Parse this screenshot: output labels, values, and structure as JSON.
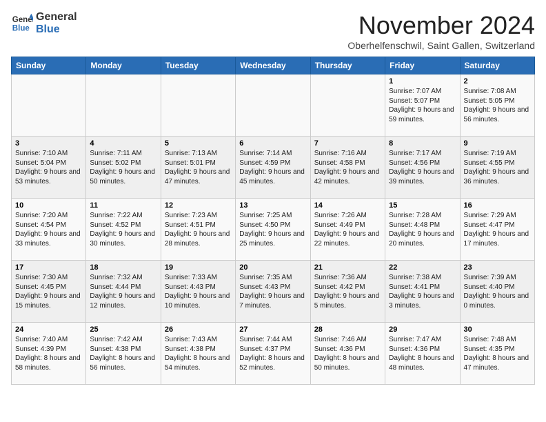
{
  "header": {
    "logo_general": "General",
    "logo_blue": "Blue",
    "month": "November 2024",
    "location": "Oberhelfenschwil, Saint Gallen, Switzerland"
  },
  "weekdays": [
    "Sunday",
    "Monday",
    "Tuesday",
    "Wednesday",
    "Thursday",
    "Friday",
    "Saturday"
  ],
  "weeks": [
    [
      {
        "day": "",
        "info": ""
      },
      {
        "day": "",
        "info": ""
      },
      {
        "day": "",
        "info": ""
      },
      {
        "day": "",
        "info": ""
      },
      {
        "day": "",
        "info": ""
      },
      {
        "day": "1",
        "info": "Sunrise: 7:07 AM\nSunset: 5:07 PM\nDaylight: 9 hours and 59 minutes."
      },
      {
        "day": "2",
        "info": "Sunrise: 7:08 AM\nSunset: 5:05 PM\nDaylight: 9 hours and 56 minutes."
      }
    ],
    [
      {
        "day": "3",
        "info": "Sunrise: 7:10 AM\nSunset: 5:04 PM\nDaylight: 9 hours and 53 minutes."
      },
      {
        "day": "4",
        "info": "Sunrise: 7:11 AM\nSunset: 5:02 PM\nDaylight: 9 hours and 50 minutes."
      },
      {
        "day": "5",
        "info": "Sunrise: 7:13 AM\nSunset: 5:01 PM\nDaylight: 9 hours and 47 minutes."
      },
      {
        "day": "6",
        "info": "Sunrise: 7:14 AM\nSunset: 4:59 PM\nDaylight: 9 hours and 45 minutes."
      },
      {
        "day": "7",
        "info": "Sunrise: 7:16 AM\nSunset: 4:58 PM\nDaylight: 9 hours and 42 minutes."
      },
      {
        "day": "8",
        "info": "Sunrise: 7:17 AM\nSunset: 4:56 PM\nDaylight: 9 hours and 39 minutes."
      },
      {
        "day": "9",
        "info": "Sunrise: 7:19 AM\nSunset: 4:55 PM\nDaylight: 9 hours and 36 minutes."
      }
    ],
    [
      {
        "day": "10",
        "info": "Sunrise: 7:20 AM\nSunset: 4:54 PM\nDaylight: 9 hours and 33 minutes."
      },
      {
        "day": "11",
        "info": "Sunrise: 7:22 AM\nSunset: 4:52 PM\nDaylight: 9 hours and 30 minutes."
      },
      {
        "day": "12",
        "info": "Sunrise: 7:23 AM\nSunset: 4:51 PM\nDaylight: 9 hours and 28 minutes."
      },
      {
        "day": "13",
        "info": "Sunrise: 7:25 AM\nSunset: 4:50 PM\nDaylight: 9 hours and 25 minutes."
      },
      {
        "day": "14",
        "info": "Sunrise: 7:26 AM\nSunset: 4:49 PM\nDaylight: 9 hours and 22 minutes."
      },
      {
        "day": "15",
        "info": "Sunrise: 7:28 AM\nSunset: 4:48 PM\nDaylight: 9 hours and 20 minutes."
      },
      {
        "day": "16",
        "info": "Sunrise: 7:29 AM\nSunset: 4:47 PM\nDaylight: 9 hours and 17 minutes."
      }
    ],
    [
      {
        "day": "17",
        "info": "Sunrise: 7:30 AM\nSunset: 4:45 PM\nDaylight: 9 hours and 15 minutes."
      },
      {
        "day": "18",
        "info": "Sunrise: 7:32 AM\nSunset: 4:44 PM\nDaylight: 9 hours and 12 minutes."
      },
      {
        "day": "19",
        "info": "Sunrise: 7:33 AM\nSunset: 4:43 PM\nDaylight: 9 hours and 10 minutes."
      },
      {
        "day": "20",
        "info": "Sunrise: 7:35 AM\nSunset: 4:43 PM\nDaylight: 9 hours and 7 minutes."
      },
      {
        "day": "21",
        "info": "Sunrise: 7:36 AM\nSunset: 4:42 PM\nDaylight: 9 hours and 5 minutes."
      },
      {
        "day": "22",
        "info": "Sunrise: 7:38 AM\nSunset: 4:41 PM\nDaylight: 9 hours and 3 minutes."
      },
      {
        "day": "23",
        "info": "Sunrise: 7:39 AM\nSunset: 4:40 PM\nDaylight: 9 hours and 0 minutes."
      }
    ],
    [
      {
        "day": "24",
        "info": "Sunrise: 7:40 AM\nSunset: 4:39 PM\nDaylight: 8 hours and 58 minutes."
      },
      {
        "day": "25",
        "info": "Sunrise: 7:42 AM\nSunset: 4:38 PM\nDaylight: 8 hours and 56 minutes."
      },
      {
        "day": "26",
        "info": "Sunrise: 7:43 AM\nSunset: 4:38 PM\nDaylight: 8 hours and 54 minutes."
      },
      {
        "day": "27",
        "info": "Sunrise: 7:44 AM\nSunset: 4:37 PM\nDaylight: 8 hours and 52 minutes."
      },
      {
        "day": "28",
        "info": "Sunrise: 7:46 AM\nSunset: 4:36 PM\nDaylight: 8 hours and 50 minutes."
      },
      {
        "day": "29",
        "info": "Sunrise: 7:47 AM\nSunset: 4:36 PM\nDaylight: 8 hours and 48 minutes."
      },
      {
        "day": "30",
        "info": "Sunrise: 7:48 AM\nSunset: 4:35 PM\nDaylight: 8 hours and 47 minutes."
      }
    ]
  ]
}
